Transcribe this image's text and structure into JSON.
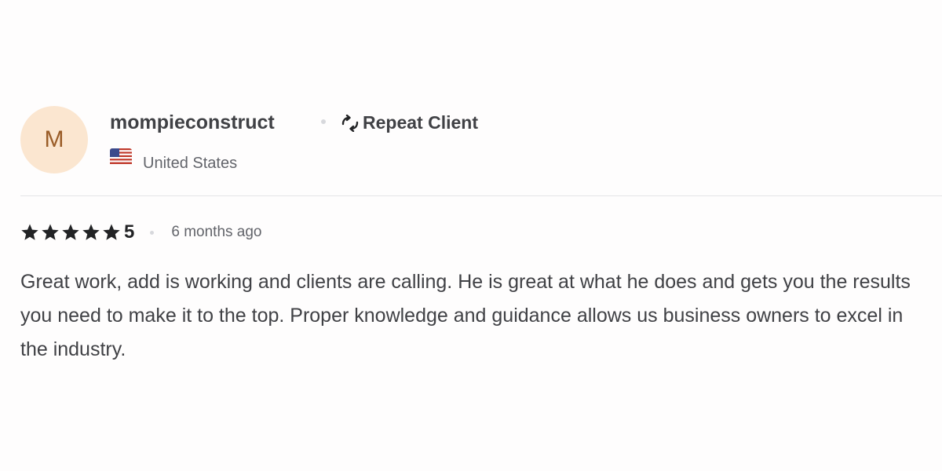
{
  "reviewer": {
    "avatar_initial": "M",
    "avatar_bg": "#fbe6d0",
    "avatar_fg": "#9a5d28",
    "username": "mompieconstruct",
    "badge_icon": "repeat-arrows-icon",
    "badge_label": "Repeat Client",
    "country_flag": "us-flag-icon",
    "country": "United States"
  },
  "review": {
    "rating_stars": 5,
    "rating_value": "5",
    "time_ago": "6 months ago",
    "text": "Great work, add is working and clients are calling. He is great at what he does and gets you the results you need to make it to the top. Proper knowledge and guidance allows us business owners to excel in the industry.",
    "star_color": "#222325"
  }
}
